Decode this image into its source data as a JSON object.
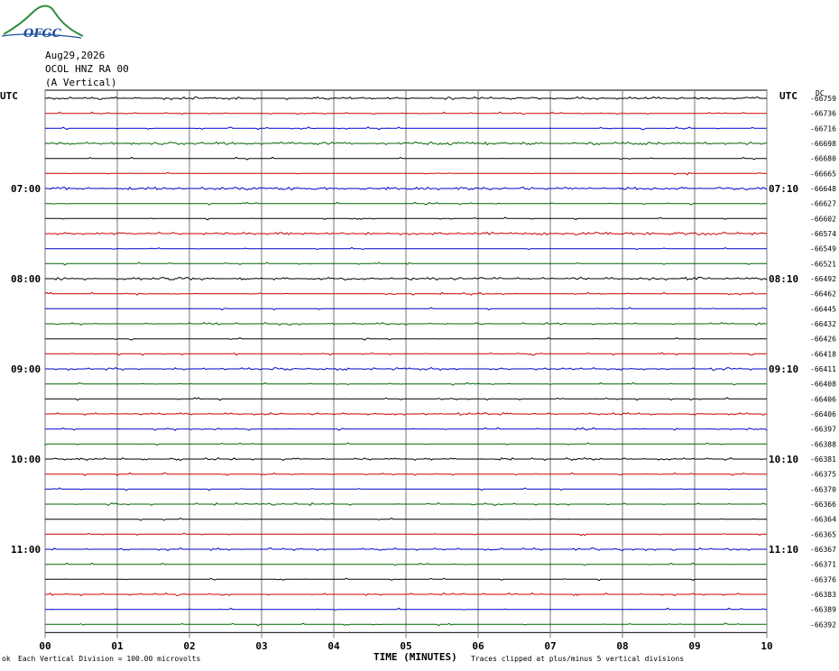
{
  "logo": {
    "text": "OFGC"
  },
  "header": {
    "date": "Aug29,2026",
    "channel": "OCOL HNZ RA 00",
    "component": "(A Vertical)"
  },
  "left_axis_label": "UTC",
  "right_axis_label": "UTC",
  "dc_label": "DC",
  "footer": {
    "scale": "Each Vertical Division =  100.00 microvolts",
    "xlabel": "TIME (MINUTES)",
    "clip": "Traces clipped at plus/minus 5 vertical divisions",
    "mark": "ok"
  },
  "colors": {
    "cycle": [
      "#000000",
      "#cc0000",
      "#0000cc",
      "#006600"
    ],
    "grid": "#777777"
  },
  "chart_data": {
    "type": "line",
    "title": "",
    "xlabel": "TIME (MINUTES)",
    "ylabel": "",
    "xlim": [
      0,
      10
    ],
    "x_ticks": [
      "00",
      "01",
      "02",
      "03",
      "04",
      "05",
      "06",
      "07",
      "08",
      "09",
      "10"
    ],
    "left_time_labels": [
      {
        "row": 6,
        "text": "07:00"
      },
      {
        "row": 12,
        "text": "08:00"
      },
      {
        "row": 18,
        "text": "09:00"
      },
      {
        "row": 24,
        "text": "10:00"
      },
      {
        "row": 30,
        "text": "11:00"
      }
    ],
    "right_time_labels": [
      {
        "row": 6,
        "text": "07:10"
      },
      {
        "row": 12,
        "text": "08:10"
      },
      {
        "row": 18,
        "text": "09:10"
      },
      {
        "row": 24,
        "text": "10:10"
      },
      {
        "row": 30,
        "text": "11:10"
      }
    ],
    "trace_dc_offsets": [
      "-66759",
      "-66736",
      "-66716",
      "-66698",
      "-66680",
      "-66665",
      "-66648",
      "-66627",
      "-66602",
      "-66574",
      "-66549",
      "-66521",
      "-66492",
      "-66462",
      "-66445",
      "-66432",
      "-66426",
      "-66418",
      "-66411",
      "-66408",
      "-66406",
      "-66406",
      "-66397",
      "-66388",
      "-66381",
      "-66375",
      "-66370",
      "-66366",
      "-66364",
      "-66365",
      "-66367",
      "-66371",
      "-66376",
      "-66383",
      "-66389",
      "-66392"
    ],
    "trace_activity": [
      0.35,
      0.1,
      0.08,
      0.45,
      0.05,
      0.05,
      0.5,
      0.05,
      0.05,
      0.4,
      0.05,
      0.05,
      0.4,
      0.15,
      0.05,
      0.15,
      0.05,
      0.1,
      0.25,
      0.05,
      0.05,
      0.3,
      0.1,
      0.05,
      0.25,
      0.1,
      0.05,
      0.15,
      0.05,
      0.05,
      0.2,
      0.05,
      0.05,
      0.15,
      0.05,
      0.05
    ]
  }
}
